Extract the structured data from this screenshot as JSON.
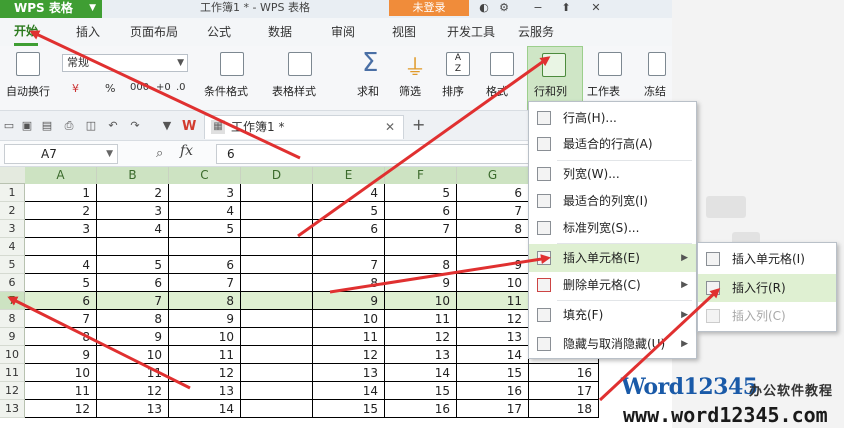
{
  "titlebar": {
    "app_name": "WPS 表格",
    "window_title": "工作簿1 * - WPS 表格",
    "login": "未登录"
  },
  "menu_tabs": [
    "开始",
    "插入",
    "页面布局",
    "公式",
    "数据",
    "审阅",
    "视图",
    "开发工具",
    "云服务"
  ],
  "ribbon": {
    "wrap_text": "自动换行",
    "number_format": "常规",
    "percent": "%",
    "cond_format": "条件格式",
    "table_style": "表格样式",
    "sum": "求和",
    "filter": "筛选",
    "sort": "排序",
    "format": "格式",
    "row_col": "行和列",
    "worksheet": "工作表",
    "freeze": "冻结"
  },
  "doc_tab": {
    "name": "工作簿1 *",
    "close": "✕",
    "add": "+"
  },
  "formula_bar": {
    "name_box": "A7",
    "fx": "fx",
    "value": "6"
  },
  "grid": {
    "columns": [
      "A",
      "B",
      "C",
      "D",
      "E",
      "F",
      "G",
      "H"
    ],
    "rows": [
      {
        "n": "1",
        "cells": [
          "1",
          "2",
          "3",
          "",
          "4",
          "5",
          "6",
          ""
        ]
      },
      {
        "n": "2",
        "cells": [
          "2",
          "3",
          "4",
          "",
          "5",
          "6",
          "7",
          ""
        ]
      },
      {
        "n": "3",
        "cells": [
          "3",
          "4",
          "5",
          "",
          "6",
          "7",
          "8",
          ""
        ]
      },
      {
        "n": "4",
        "cells": [
          "",
          "",
          "",
          "",
          "",
          "",
          "",
          ""
        ]
      },
      {
        "n": "5",
        "cells": [
          "4",
          "5",
          "6",
          "",
          "7",
          "8",
          "9",
          ""
        ]
      },
      {
        "n": "6",
        "cells": [
          "5",
          "6",
          "7",
          "",
          "8",
          "9",
          "10",
          ""
        ]
      },
      {
        "n": "7",
        "cells": [
          "6",
          "7",
          "8",
          "",
          "9",
          "10",
          "11",
          ""
        ]
      },
      {
        "n": "8",
        "cells": [
          "7",
          "8",
          "9",
          "",
          "10",
          "11",
          "12",
          ""
        ]
      },
      {
        "n": "9",
        "cells": [
          "8",
          "9",
          "10",
          "",
          "11",
          "12",
          "13",
          ""
        ]
      },
      {
        "n": "10",
        "cells": [
          "9",
          "10",
          "11",
          "",
          "12",
          "13",
          "14",
          ""
        ]
      },
      {
        "n": "11",
        "cells": [
          "10",
          "11",
          "12",
          "",
          "13",
          "14",
          "15",
          "16"
        ]
      },
      {
        "n": "12",
        "cells": [
          "11",
          "12",
          "13",
          "",
          "14",
          "15",
          "16",
          "17"
        ]
      },
      {
        "n": "13",
        "cells": [
          "12",
          "13",
          "14",
          "",
          "15",
          "16",
          "17",
          "18"
        ]
      }
    ]
  },
  "menu_rowcol": {
    "items": [
      "行高(H)...",
      "最适合的行高(A)",
      "列宽(W)...",
      "最适合的列宽(I)",
      "标准列宽(S)...",
      "插入单元格(E)",
      "删除单元格(C)",
      "填充(F)",
      "隐藏与取消隐藏(U)"
    ]
  },
  "menu_insert": {
    "items": [
      "插入单元格(I)",
      "插入行(R)",
      "插入列(C)"
    ]
  },
  "watermark": {
    "brand": "Word12345",
    "sub": "办公软件教程",
    "url": "www.word12345.com"
  },
  "colors": {
    "accent": "#3f9e33",
    "arrow": "#e03030",
    "highlight": "#dff0d2"
  }
}
